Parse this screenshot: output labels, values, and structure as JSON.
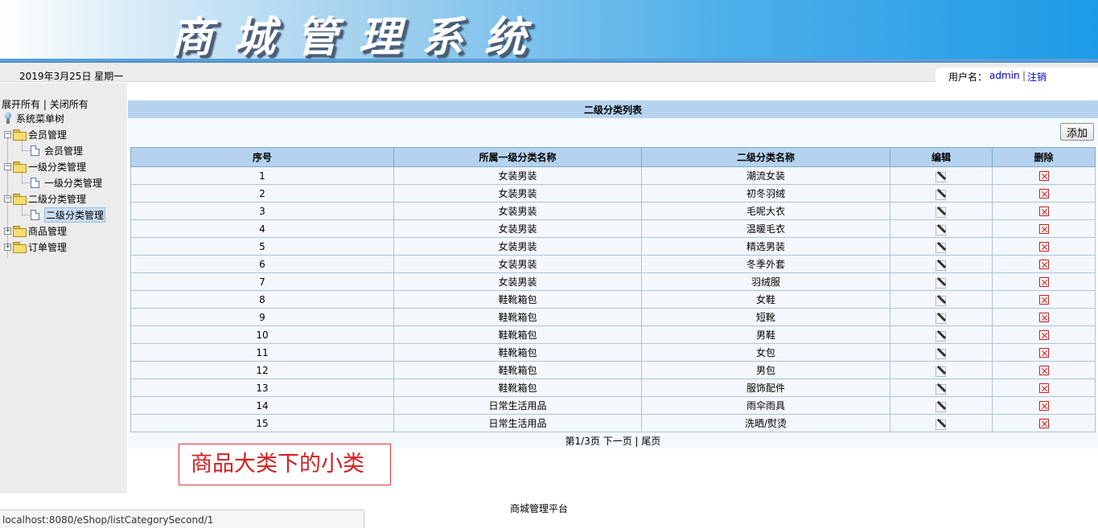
{
  "header": {
    "title": "商城管理系统"
  },
  "topbar": {
    "date": "2019年3月25日 星期一",
    "user_label": "用户名：",
    "user_name": "admin",
    "separator": "|",
    "logout_label": "注销"
  },
  "sidebar": {
    "expand_all": "展开所有",
    "separator": "|",
    "collapse_all": "关闭所有",
    "root_label": "系统菜单树",
    "groups": [
      {
        "label": "会员管理",
        "expanded": true,
        "children": [
          "会员管理"
        ]
      },
      {
        "label": "一级分类管理",
        "expanded": true,
        "children": [
          "一级分类管理"
        ]
      },
      {
        "label": "二级分类管理",
        "expanded": true,
        "children": [
          "二级分类管理"
        ]
      },
      {
        "label": "商品管理",
        "expanded": false,
        "children": []
      },
      {
        "label": "订单管理",
        "expanded": false,
        "children": []
      }
    ],
    "selected": "二级分类管理"
  },
  "main": {
    "caption": "二级分类列表",
    "add_button": "添加",
    "columns": [
      "序号",
      "所属一级分类名称",
      "二级分类名称",
      "编辑",
      "删除"
    ],
    "rows": [
      [
        "1",
        "女装男装",
        "潮流女装"
      ],
      [
        "2",
        "女装男装",
        "初冬羽绒"
      ],
      [
        "3",
        "女装男装",
        "毛呢大衣"
      ],
      [
        "4",
        "女装男装",
        "温暖毛衣"
      ],
      [
        "5",
        "女装男装",
        "精选男装"
      ],
      [
        "6",
        "女装男装",
        "冬季外套"
      ],
      [
        "7",
        "女装男装",
        "羽绒服"
      ],
      [
        "8",
        "鞋靴箱包",
        "女鞋"
      ],
      [
        "9",
        "鞋靴箱包",
        "短靴"
      ],
      [
        "10",
        "鞋靴箱包",
        "男鞋"
      ],
      [
        "11",
        "鞋靴箱包",
        "女包"
      ],
      [
        "12",
        "鞋靴箱包",
        "男包"
      ],
      [
        "13",
        "鞋靴箱包",
        "服饰配件"
      ],
      [
        "14",
        "日常生活用品",
        "雨伞雨具"
      ],
      [
        "15",
        "日常生活用品",
        "洗晒/熨烫"
      ]
    ],
    "pager": {
      "page_info": "第1/3页",
      "next": "下一页",
      "separator": "|",
      "last": "尾页"
    }
  },
  "annotation": "商品大类下的小类",
  "footer": "商城管理平台",
  "status_url": "localhost:8080/eShop/listCategorySecond/1",
  "icons": {
    "edit": "edit-icon",
    "delete": "delete-icon",
    "folder": "folder-icon",
    "document": "document-icon"
  },
  "colors": {
    "header_bar": "#b5d3ef",
    "annotation": "#d31f1f",
    "link": "#0000cc"
  }
}
